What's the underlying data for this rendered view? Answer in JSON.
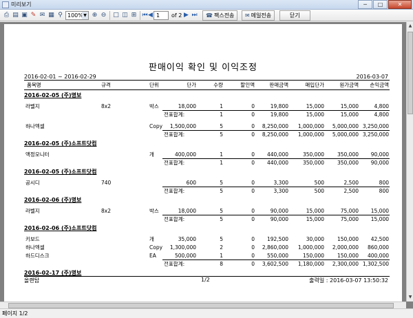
{
  "window": {
    "title": "미리보기",
    "minimize": "─",
    "maximize": "□",
    "close": "✕"
  },
  "toolbar": {
    "zoom": "100%",
    "page_current": "1",
    "page_total": "of 2",
    "fax_label": "팩스전송",
    "mail_label": "메일전송",
    "close_label": "닫기"
  },
  "report": {
    "title": "판매이익 확인 및 이익조정",
    "date_range": "2016-02-01 ~ 2016-02-29",
    "report_date": "2016-03-07",
    "columns": [
      "품목명",
      "규격",
      "단위",
      "단가",
      "수량",
      "할인액",
      "판매금액",
      "매입단가",
      "원가금액",
      "손익금액"
    ],
    "subtotal_label": "전표합계:",
    "groups": [
      {
        "title": "2016-02-05 (주)명보",
        "items": [
          [
            "라벨지",
            "8x2",
            "박스",
            "18,000",
            "1",
            "0",
            "19,800",
            "15,000",
            "15,000",
            "4,800"
          ]
        ],
        "subtotal": [
          "1",
          "0",
          "19,800",
          "15,000",
          "15,000",
          "4,800"
        ]
      },
      {
        "title": "",
        "items": [
          [
            "하나엑셀",
            "",
            "Copy",
            "1,500,000",
            "5",
            "0",
            "8,250,000",
            "1,000,000",
            "5,000,000",
            "3,250,000"
          ]
        ],
        "subtotal": [
          "5",
          "0",
          "8,250,000",
          "1,000,000",
          "5,000,000",
          "3,250,000"
        ]
      },
      {
        "title": "2016-02-05 (주)소프트닷컴",
        "items": [
          [
            "액정모니터",
            "",
            "개",
            "400,000",
            "1",
            "0",
            "440,000",
            "350,000",
            "350,000",
            "90,000"
          ]
        ],
        "subtotal": [
          "1",
          "0",
          "440,000",
          "350,000",
          "350,000",
          "90,000"
        ]
      },
      {
        "title": "2016-02-05 (주)소프트닷컴",
        "items": [
          [
            "공시디",
            "740",
            "",
            "600",
            "5",
            "0",
            "3,300",
            "500",
            "2,500",
            "800"
          ]
        ],
        "subtotal": [
          "5",
          "0",
          "3,300",
          "500",
          "2,500",
          "800"
        ]
      },
      {
        "title": "2016-02-06 (주)명보",
        "items": [
          [
            "라벨지",
            "8x2",
            "박스",
            "18,000",
            "5",
            "0",
            "90,000",
            "15,000",
            "75,000",
            "15,000"
          ]
        ],
        "subtotal": [
          "5",
          "0",
          "90,000",
          "15,000",
          "75,000",
          "15,000"
        ]
      },
      {
        "title": "2016-02-06 (주)소프트닷컴",
        "items": [
          [
            "키보드",
            "",
            "개",
            "35,000",
            "5",
            "0",
            "192,500",
            "30,000",
            "150,000",
            "42,500"
          ],
          [
            "하나엑셀",
            "",
            "Copy",
            "1,300,000",
            "2",
            "0",
            "2,860,000",
            "1,000,000",
            "2,000,000",
            "860,000"
          ],
          [
            "하드디스크",
            "",
            "EA",
            "500,000",
            "1",
            "0",
            "550,000",
            "150,000",
            "150,000",
            "400,000"
          ]
        ],
        "subtotal": [
          "8",
          "0",
          "3,602,500",
          "1,180,000",
          "2,300,000",
          "1,302,500"
        ]
      },
      {
        "title": "2016-02-17 (주)명보",
        "items": [],
        "subtotal": null
      }
    ],
    "footer_left": "올랜탑",
    "footer_page": "1/2",
    "footer_right": "출력일 : 2016-03-07    13:50:32"
  },
  "status": {
    "text": "페이지 1/2"
  }
}
